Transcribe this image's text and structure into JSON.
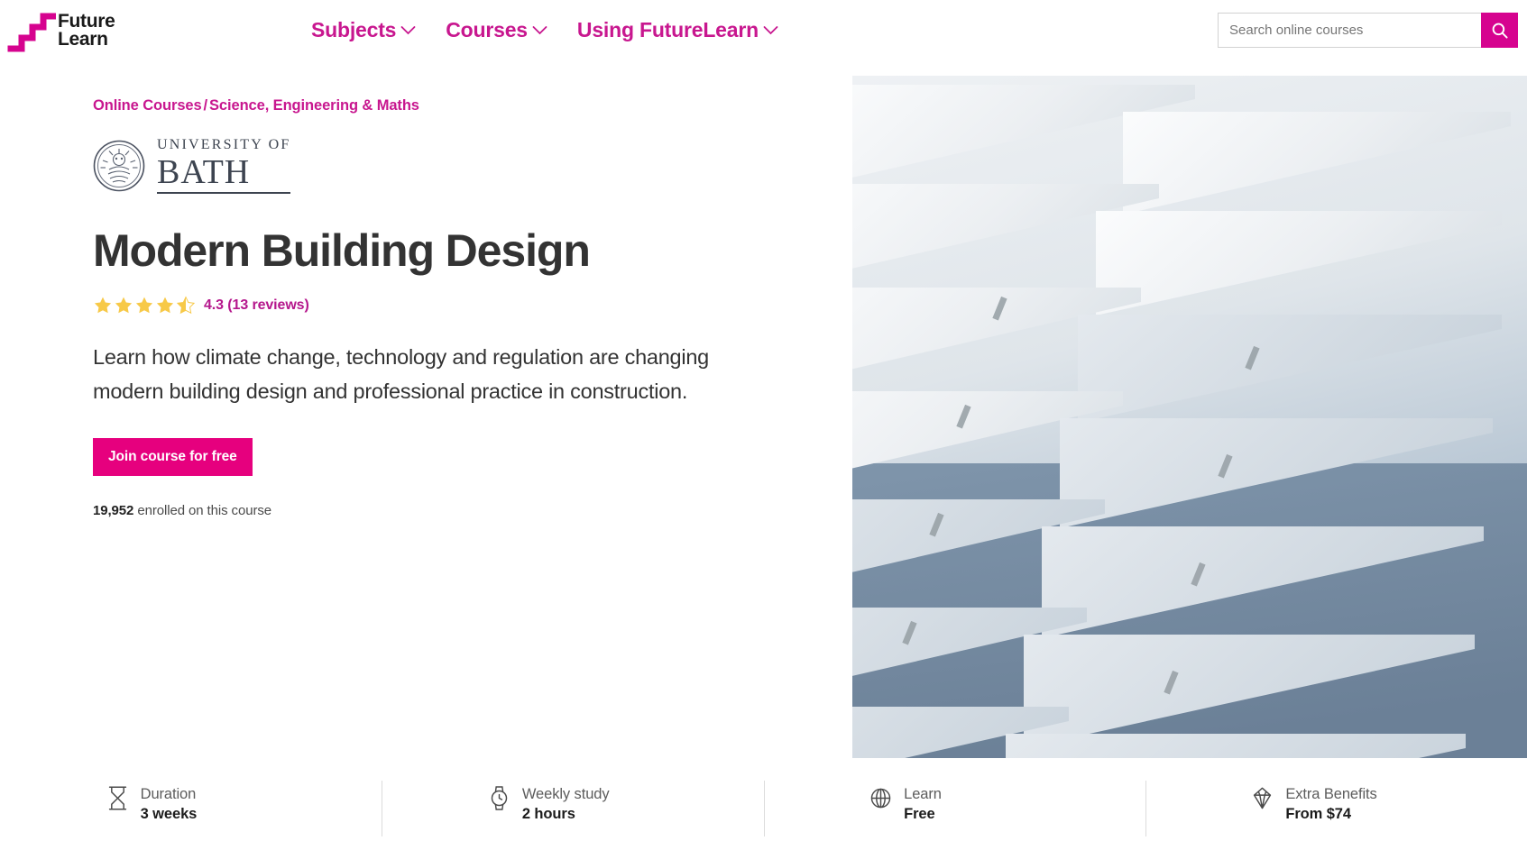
{
  "colors": {
    "brand_magenta": "#d6038f",
    "nav_magenta": "#c8178f",
    "cta_magenta": "#e6007e",
    "star_gold": "#f7c948",
    "text_dark": "#333333",
    "bath_grey": "#3d4450"
  },
  "header": {
    "logo": {
      "name": "FutureLearn",
      "line1": "Future",
      "line2": "Learn",
      "mark_icon": "staircase-icon"
    },
    "nav": [
      {
        "label": "Subjects",
        "icon": "chevron-down-icon"
      },
      {
        "label": "Courses",
        "icon": "chevron-down-icon"
      },
      {
        "label": "Using FutureLearn",
        "icon": "chevron-down-icon"
      }
    ],
    "search": {
      "placeholder": "Search online courses",
      "value": "",
      "button_icon": "search-icon"
    }
  },
  "breadcrumb": {
    "items": [
      "Online Courses",
      "Science, Engineering & Maths"
    ],
    "separator": "/"
  },
  "partner": {
    "crest_icon": "university-crest-icon",
    "prefix": "UNIVERSITY OF",
    "name": "BATH"
  },
  "course": {
    "title": "Modern Building Design",
    "rating": {
      "score": "4.3",
      "reviews_text": "4.3 (13 reviews)",
      "stars_filled": 4,
      "stars_half": 1,
      "stars_total": 5
    },
    "description": "Learn how climate change, technology and regulation are changing modern building design and professional practice in construction.",
    "cta_label": "Join course for free",
    "enrolled_count": "19,952",
    "enrolled_suffix": "enrolled on this course"
  },
  "hero": {
    "alt": "Rows of angled white architectural louvre fins on a glass building facade",
    "icon": "hero-image"
  },
  "stats": [
    {
      "icon": "hourglass-icon",
      "label": "Duration",
      "value": "3 weeks"
    },
    {
      "icon": "watch-icon",
      "label": "Weekly study",
      "value": "2 hours"
    },
    {
      "icon": "globe-icon",
      "label": "Learn",
      "value": "Free"
    },
    {
      "icon": "diamond-icon",
      "label": "Extra Benefits",
      "value": "From $74"
    }
  ]
}
